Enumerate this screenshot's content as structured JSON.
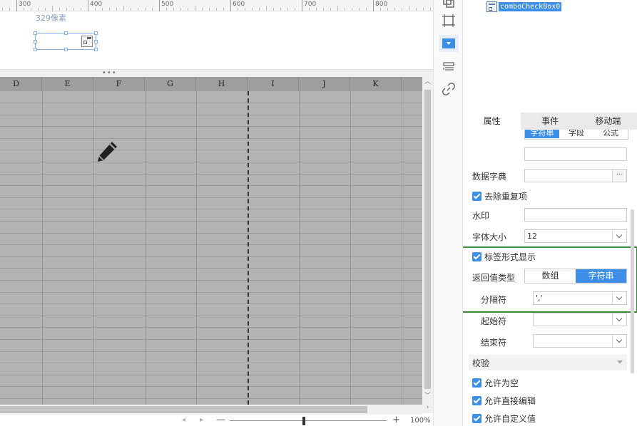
{
  "ruler": {
    "labels": [
      "300",
      "400",
      "500",
      "600",
      "700",
      "800"
    ]
  },
  "canvas": {
    "position_label": "329像素"
  },
  "sheet": {
    "columns": [
      "D",
      "E",
      "F",
      "G",
      "H",
      "I",
      "J",
      "K"
    ]
  },
  "zoom": {
    "minus": "—",
    "plus": "+",
    "level": "100%",
    "nav_left": "◂",
    "nav_right": "▸"
  },
  "tree": {
    "node_label": "comboCheckBox0"
  },
  "tabs": [
    "属性",
    "事件",
    "移动端"
  ],
  "props": {
    "top_seg": [
      "字符串",
      "字段",
      "公式"
    ],
    "dict_label": "数据字典",
    "dict_btn": "···",
    "dedupe_label": "去除重复项",
    "watermark_label": "水印",
    "font_size_label": "字体大小",
    "font_size_value": "12",
    "tag_display_label": "标签形式显示",
    "return_type_label": "返回值类型",
    "return_type_options": [
      "数组",
      "字符串"
    ],
    "return_type_selected": "字符串",
    "separator_label": "分隔符",
    "separator_value": "','",
    "start_label": "起始符",
    "end_label": "结束符",
    "verify_section": "校验",
    "allow_empty_label": "允许为空",
    "allow_edit_label": "允许直接编辑",
    "allow_custom_label": "允许自定义值"
  },
  "colors": {
    "accent": "#3c8ee6",
    "highlight": "#3b8a3b",
    "sheet_bg": "#b3b3b3"
  }
}
